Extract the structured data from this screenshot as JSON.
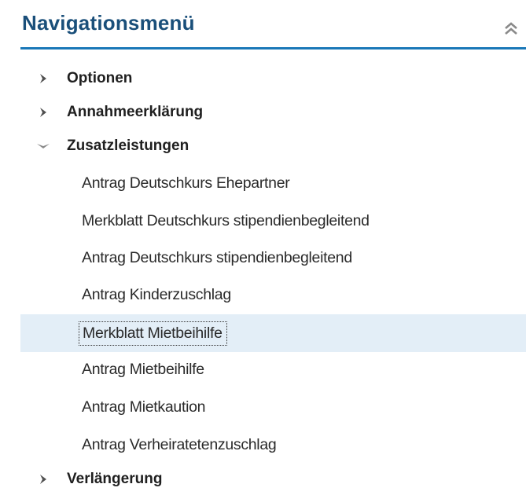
{
  "panel": {
    "title": "Navigationsmenü",
    "collapse_icon": "double-chevron-up-icon",
    "accent_color": "#1a78b8",
    "title_color": "#1a4f7a",
    "selected_bg": "#e3eef7"
  },
  "menu": {
    "items": [
      {
        "label": "Optionen",
        "state": "collapsed",
        "icon": "chevron-right-icon"
      },
      {
        "label": "Annahmeerklärung",
        "state": "collapsed",
        "icon": "chevron-right-icon"
      },
      {
        "label": "Zusatzleistungen",
        "state": "expanded",
        "icon": "chevron-down-icon",
        "children": [
          {
            "label": "Antrag Deutschkurs Ehepartner"
          },
          {
            "label": "Merkblatt Deutschkurs stipendienbegleitend"
          },
          {
            "label": "Antrag Deutschkurs stipendienbegleitend"
          },
          {
            "label": "Antrag Kinderzuschlag"
          },
          {
            "label": "Merkblatt Mietbeihilfe",
            "selected": true
          },
          {
            "label": "Antrag Mietbeihilfe"
          },
          {
            "label": "Antrag Mietkaution"
          },
          {
            "label": "Antrag Verheiratetenzuschlag"
          }
        ]
      },
      {
        "label": "Verlängerung",
        "state": "collapsed",
        "icon": "chevron-right-icon"
      }
    ]
  }
}
